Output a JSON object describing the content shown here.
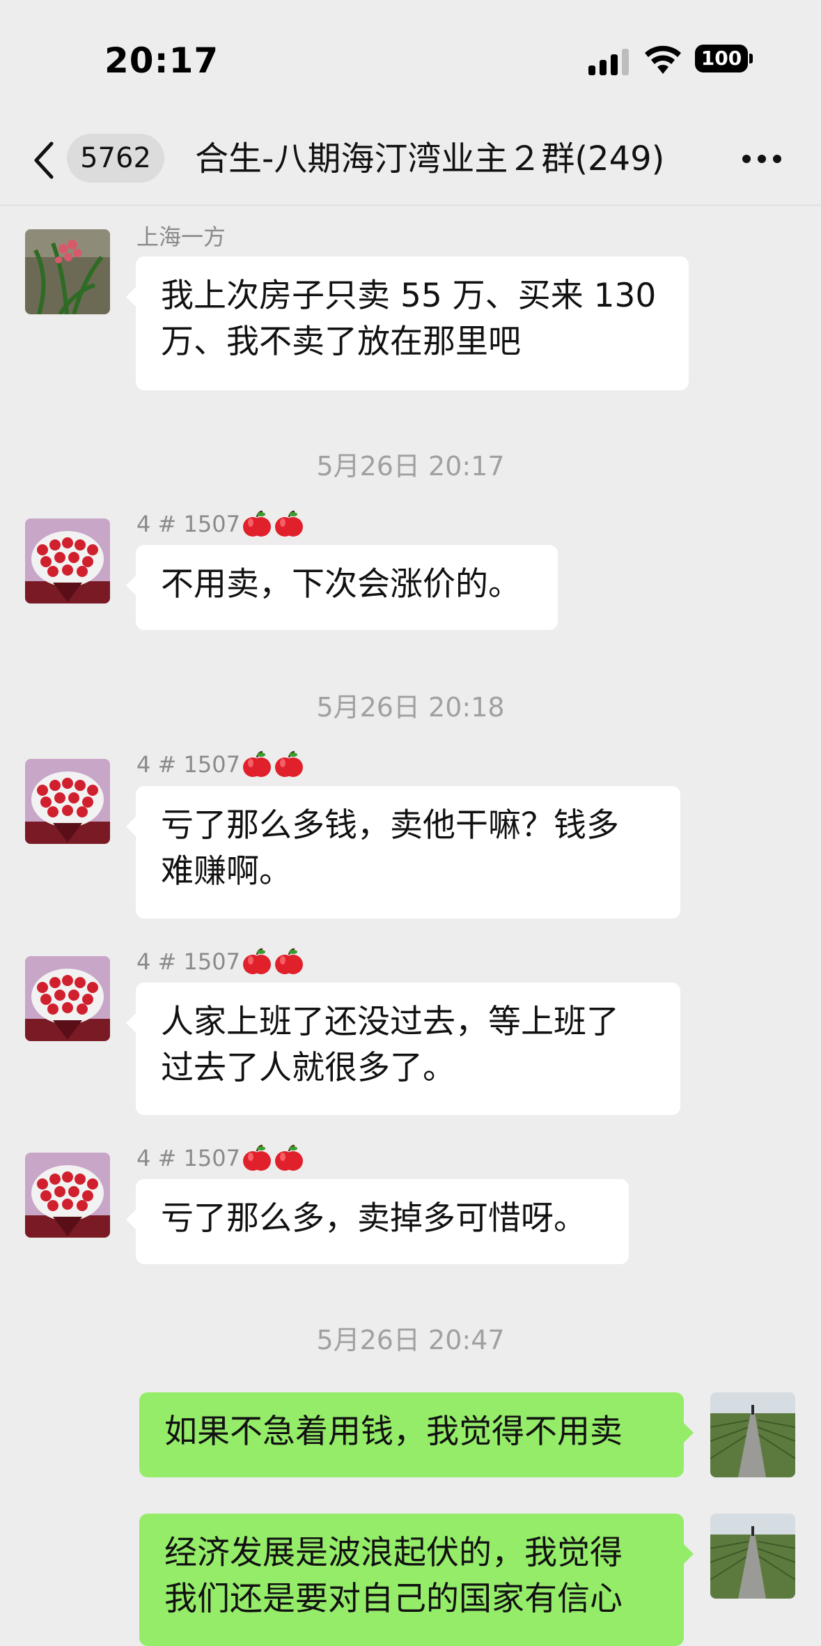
{
  "status_bar": {
    "time": "20:17",
    "battery": "100"
  },
  "nav": {
    "unread_count": "5762",
    "title": "合生-八期海汀湾业主２群(249)"
  },
  "messages": [
    {
      "sender": "上海一方",
      "text_line1": "我上次房子只卖 55 万、买来 130",
      "text_line2": "万、我不卖了放在那里吧"
    },
    {
      "timestamp": "5月26日 20:17"
    },
    {
      "sender": "4 # 1507",
      "text": "不用卖，下次会涨价的。"
    },
    {
      "timestamp": "5月26日 20:18"
    },
    {
      "sender": "4 # 1507",
      "text_line1": "亏了那么多钱，卖他干嘛？钱多",
      "text_line2": "难赚啊。"
    },
    {
      "sender": "4 # 1507",
      "text_line1": "人家上班了还没过去，等上班了",
      "text_line2": "过去了人就很多了。"
    },
    {
      "sender": "4 # 1507",
      "text": "亏了那么多，卖掉多可惜呀。"
    },
    {
      "timestamp": "5月26日 20:47"
    },
    {
      "sender": "",
      "text": "如果不急着用钱，我觉得不用卖"
    },
    {
      "sender": "",
      "text_line1": "经济发展是波浪起伏的，我觉得",
      "text_line2": "我们还是要对自己的国家有信心"
    }
  ],
  "icons": {
    "back": "chevron-left-icon",
    "more": "ellipsis-icon",
    "sender_emoji": "apple-icon"
  },
  "colors": {
    "background": "#ededed",
    "my_bubble": "#95ec69",
    "their_bubble": "#ffffff"
  }
}
